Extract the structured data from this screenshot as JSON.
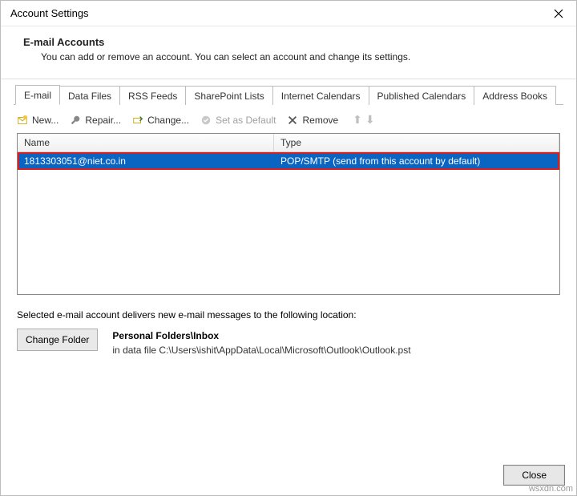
{
  "window": {
    "title": "Account Settings"
  },
  "header": {
    "title": "E-mail Accounts",
    "description": "You can add or remove an account. You can select an account and change its settings."
  },
  "tabs": [
    "E-mail",
    "Data Files",
    "RSS Feeds",
    "SharePoint Lists",
    "Internet Calendars",
    "Published Calendars",
    "Address Books"
  ],
  "toolbar": {
    "new": "New...",
    "repair": "Repair...",
    "change": "Change...",
    "setDefault": "Set as Default",
    "remove": "Remove"
  },
  "list": {
    "headers": {
      "name": "Name",
      "type": "Type"
    },
    "rows": [
      {
        "name": "1813303051@niet.co.in",
        "type": "POP/SMTP (send from this account by default)"
      }
    ]
  },
  "info": {
    "intro": "Selected e-mail account delivers new e-mail messages to the following location:",
    "changeFolder": "Change Folder",
    "location": "Personal Folders\\Inbox",
    "path": "in data file C:\\Users\\ishit\\AppData\\Local\\Microsoft\\Outlook\\Outlook.pst"
  },
  "footer": {
    "close": "Close"
  },
  "watermark": "wsxdn.com"
}
